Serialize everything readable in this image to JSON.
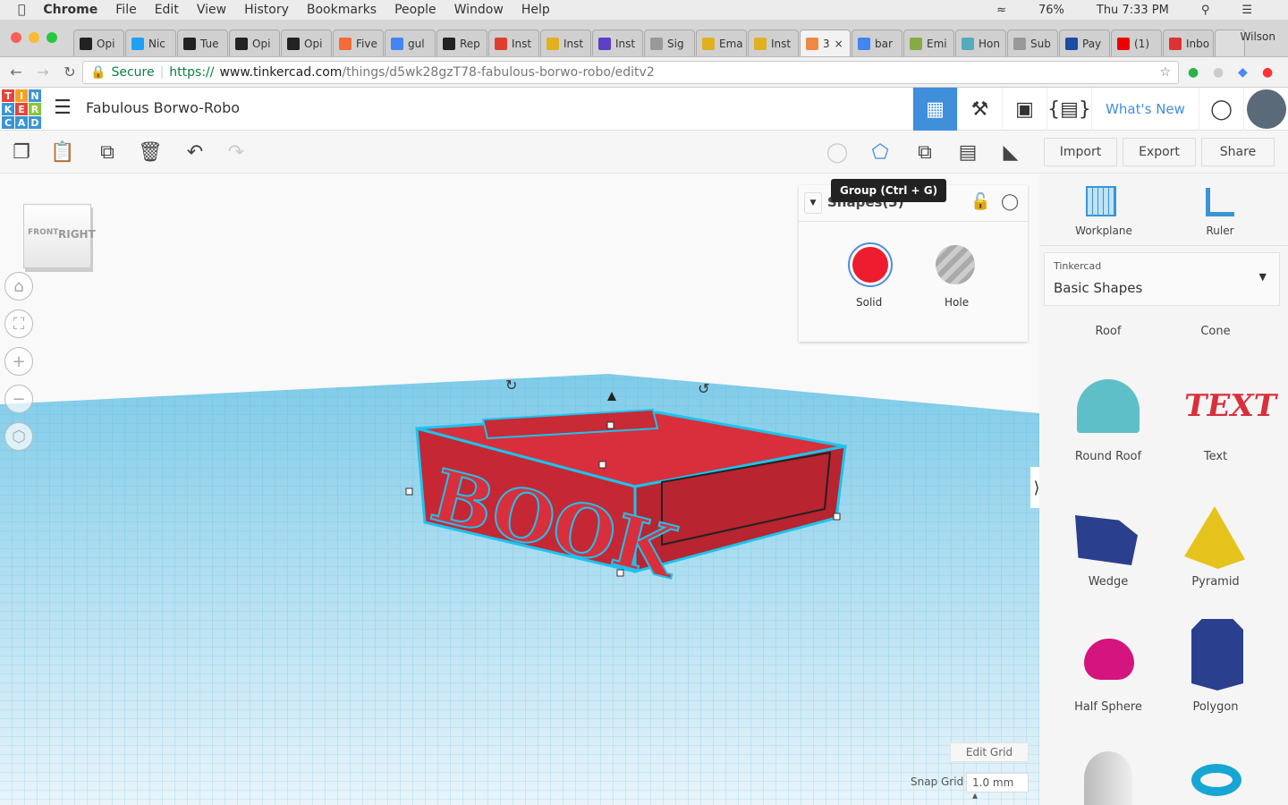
{
  "menubar": {
    "app": "Chrome",
    "items": [
      "File",
      "Edit",
      "View",
      "History",
      "Bookmarks",
      "People",
      "Window",
      "Help"
    ],
    "battery": "76%",
    "clock": "Thu 7:33 PM"
  },
  "tabs": [
    {
      "label": "Opi",
      "icon": "nyt",
      "color": "#222"
    },
    {
      "label": "Nic",
      "icon": "twitter",
      "color": "#1da1f2"
    },
    {
      "label": "Tue",
      "icon": "nyt",
      "color": "#222"
    },
    {
      "label": "Opi",
      "icon": "nyt",
      "color": "#222"
    },
    {
      "label": "Opi",
      "icon": "nyt",
      "color": "#222"
    },
    {
      "label": "Five",
      "icon": "fivethirtyeight",
      "color": "#f26b38"
    },
    {
      "label": "gul",
      "icon": "google",
      "color": "#4285f4"
    },
    {
      "label": "Rep",
      "icon": "nyt",
      "color": "#222"
    },
    {
      "label": "Inst",
      "icon": "instructure",
      "color": "#e03e2d"
    },
    {
      "label": "Inst",
      "icon": "robot",
      "color": "#e0b020"
    },
    {
      "label": "Inst",
      "icon": "list",
      "color": "#5b3fc4"
    },
    {
      "label": "Sig",
      "icon": "doc",
      "color": "#999"
    },
    {
      "label": "Ema",
      "icon": "robot",
      "color": "#e0b020"
    },
    {
      "label": "Inst",
      "icon": "robot",
      "color": "#e0b020"
    },
    {
      "label": "3",
      "icon": "tinkercad",
      "color": "#e84",
      "active": true
    },
    {
      "label": "bar",
      "icon": "google",
      "color": "#4285f4"
    },
    {
      "label": "Emi",
      "icon": "stripes",
      "color": "#8a4"
    },
    {
      "label": "Hon",
      "icon": "cloud",
      "color": "#5ab"
    },
    {
      "label": "Sub",
      "icon": "doc",
      "color": "#999"
    },
    {
      "label": "Pay",
      "icon": "uf",
      "color": "#1c4da1"
    },
    {
      "label": "(1)",
      "icon": "youtube",
      "color": "#e00"
    },
    {
      "label": "Inbo",
      "icon": "gmail",
      "color": "#d33"
    }
  ],
  "profile": "Wilson",
  "address": {
    "secure": "Secure",
    "scheme": "https://",
    "host": "www.tinkercad.com",
    "path": "/things/d5wk28gzT78-fabulous-borwo-robo/editv2"
  },
  "app": {
    "logo": [
      "T",
      "I",
      "N",
      "K",
      "E",
      "R",
      "C",
      "A",
      "D"
    ],
    "title": "Fabulous Borwo-Robo",
    "whats_new": "What's New"
  },
  "toolbar": {
    "import": "Import",
    "export": "Export",
    "share": "Share",
    "tooltip": "Group (Ctrl + G)"
  },
  "viewcube": {
    "front": "FRONT",
    "right": "RIGHT"
  },
  "inspector": {
    "title": "Shapes(3)",
    "solid": "Solid",
    "hole": "Hole",
    "solid_color": "#ed1c2e"
  },
  "model_text": "BOOK",
  "sidebar": {
    "workplane": "Workplane",
    "ruler": "Ruler",
    "library_source": "Tinkercad",
    "library": "Basic Shapes",
    "shapes": [
      "Roof",
      "Cone",
      "Round Roof",
      "Text",
      "Wedge",
      "Pyramid",
      "Half Sphere",
      "Polygon"
    ]
  },
  "grid": {
    "edit_grid": "Edit Grid",
    "snap_label": "Snap Grid",
    "snap_value": "1.0 mm"
  }
}
